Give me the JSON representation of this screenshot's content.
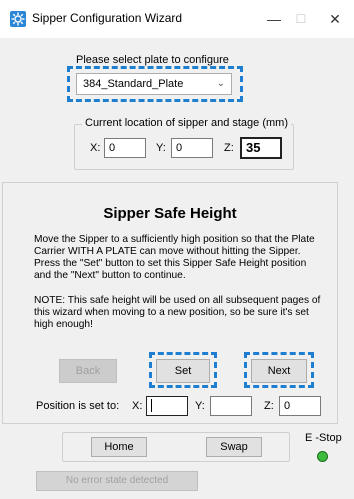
{
  "window": {
    "title": "Sipper Configuration Wizard",
    "minimize_glyph": "—",
    "maximize_glyph": "☐",
    "close_glyph": "✕"
  },
  "plate": {
    "prompt": "Please select plate to configure",
    "selected": "384_Standard_Plate"
  },
  "current_location": {
    "title": "Current location of sipper and stage (mm)",
    "x_label": "X:",
    "x_value": "0",
    "y_label": "Y:",
    "y_value": "0",
    "z_label": "Z:",
    "z_value": "35"
  },
  "wizard": {
    "heading": "Sipper Safe Height",
    "paragraph1": "Move the Sipper to a sufficiently high position so that the Plate Carrier WITH A PLATE can move without hitting the Sipper. Press the \"Set\" button to set this Sipper Safe Height position and the \"Next\" button to continue.",
    "paragraph2": "NOTE: This safe height will be used on all subsequent pages of this wizard when moving to a new position, so be sure it's set high enough!",
    "back_label": "Back",
    "set_label": "Set",
    "next_label": "Next"
  },
  "position_set": {
    "label": "Position is set to:",
    "x_label": "X:",
    "x_value": "",
    "y_label": "Y:",
    "y_value": "",
    "z_label": "Z:",
    "z_value": "0"
  },
  "bottom": {
    "home_label": "Home",
    "swap_label": "Swap",
    "estop_label": "E -Stop",
    "status_text": "No error state detected"
  },
  "colors": {
    "accent_dashed": "#1e7fd0",
    "estop_led": "#3dbb3d"
  }
}
